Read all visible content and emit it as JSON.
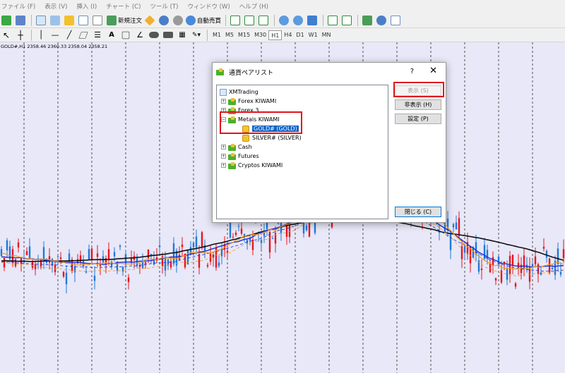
{
  "menubar": {
    "items": [
      "ファイル (F)",
      "表示 (V)",
      "挿入 (I)",
      "チャート (C)",
      "ツール (T)",
      "ウィンドウ (W)",
      "ヘルプ (H)"
    ]
  },
  "toolbar1": {
    "new_order_label": "新規注文",
    "auto_trading_label": "自動売買"
  },
  "toolbar2": {
    "timeframes": [
      "M1",
      "M5",
      "M15",
      "M30",
      "H1",
      "H4",
      "D1",
      "W1",
      "MN"
    ],
    "active_timeframe": "H1"
  },
  "chart": {
    "info_label": "GOLD#,H1  2358.46 2360.33 2358.04 2358.21",
    "colors": {
      "background": "#e8e8f8",
      "bull_candle": "#e8141e",
      "bear_candle": "#2078d8",
      "ma_long": "#111111",
      "ma_mid": "#1f2fd0",
      "ma_short": "#f29a1e"
    }
  },
  "dialog": {
    "title": "通貨ペアリスト",
    "help_label": "?",
    "close_label": "✕",
    "tree": {
      "root": "XMTrading",
      "groups": [
        {
          "label": "Forex KIWAMI",
          "expanded": false
        },
        {
          "label": "Forex 3",
          "expanded": false
        },
        {
          "label": "Metals KIWAMI",
          "expanded": true,
          "children": [
            "GOLD#  (GOLD)",
            "SILVER#  (SILVER)"
          ],
          "selected_child": "GOLD#  (GOLD)"
        },
        {
          "label": "Cash",
          "expanded": false
        },
        {
          "label": "Futures",
          "expanded": false
        },
        {
          "label": "Cryptos KIWAMI",
          "expanded": false
        }
      ]
    },
    "buttons": {
      "show": "表示 (S)",
      "hide": "非表示 (H)",
      "settings": "設定 (P)",
      "close": "閉じる (C)"
    }
  }
}
